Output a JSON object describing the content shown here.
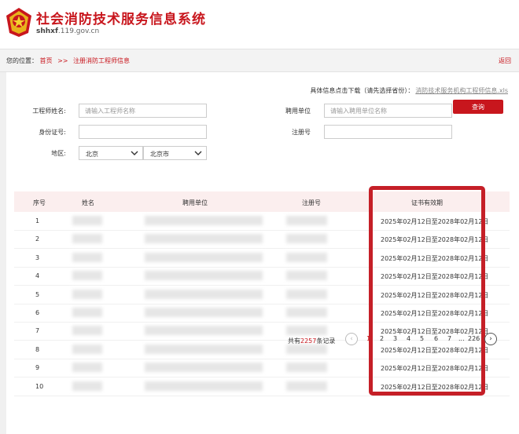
{
  "header": {
    "title": "社会消防技术服务信息系统",
    "domain_prefix": "shhxf",
    "domain_rest": ".119.gov.cn"
  },
  "breadcrumb": {
    "prefix": "您的位置：",
    "home": "首页",
    "sep": ">>",
    "current": "注册消防工程师信息",
    "back": "返回"
  },
  "download": {
    "text": "具体信息点击下载（请先选择省份）：",
    "file": "消防技术服务机构工程师信息.xls"
  },
  "form": {
    "name_label": "工程师姓名:",
    "name_placeholder": "请输入工程师名称",
    "unit_label": "聘用单位",
    "unit_placeholder": "请输入聘用单位名称",
    "id_label": "身份证号:",
    "reg_label": "注册号",
    "region_label": "地区:",
    "province": "北京",
    "city": "北京市",
    "query": "查询"
  },
  "table": {
    "headers": [
      "序号",
      "姓名",
      "聘用单位",
      "注册号",
      "证书有效期"
    ],
    "rows": [
      {
        "index": "1",
        "validity": "2025年02月12日至2028年02月12日"
      },
      {
        "index": "2",
        "validity": "2025年02月12日至2028年02月12日"
      },
      {
        "index": "3",
        "validity": "2025年02月12日至2028年02月12日"
      },
      {
        "index": "4",
        "validity": "2025年02月12日至2028年02月12日"
      },
      {
        "index": "5",
        "validity": "2025年02月12日至2028年02月12日"
      },
      {
        "index": "6",
        "validity": "2025年02月12日至2028年02月12日"
      },
      {
        "index": "7",
        "validity": "2025年02月12日至2028年02月12日"
      },
      {
        "index": "8",
        "validity": "2025年02月12日至2028年02月12日"
      },
      {
        "index": "9",
        "validity": "2025年02月12日至2028年02月12日"
      },
      {
        "index": "10",
        "validity": "2025年02月12日至2028年02月12日"
      }
    ]
  },
  "pager": {
    "total_prefix": "共有",
    "total": "2257",
    "total_suffix": "条记录",
    "prev": "‹",
    "pages": [
      "1",
      "2",
      "3",
      "4",
      "5",
      "6",
      "7"
    ],
    "ellipsis": "...",
    "last": "226",
    "next": "›",
    "current": "1"
  },
  "colors": {
    "brand": "#c8161d",
    "highlight": "#c51f27",
    "header_row": "#fbeeee"
  },
  "icons": {
    "logo": "fire-emblem",
    "select_arrow": "chevron-down-icon"
  }
}
